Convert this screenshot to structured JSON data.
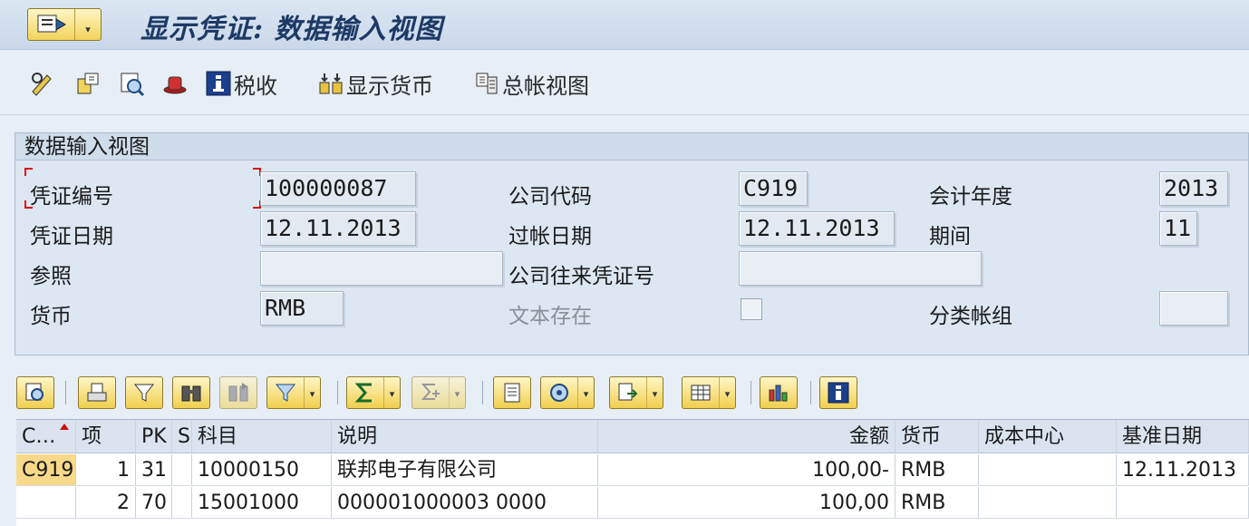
{
  "window": {
    "title": "显示凭证: 数据输入视图"
  },
  "menu_button": {
    "icon": "menu-icon",
    "dropdown": "▾"
  },
  "toolbar": {
    "items": [
      {
        "icon": "edit-glasses-icon",
        "label": ""
      },
      {
        "icon": "document-switch-icon",
        "label": ""
      },
      {
        "icon": "display-document-icon",
        "label": ""
      },
      {
        "icon": "hat-icon",
        "label": ""
      },
      {
        "icon": "info-icon",
        "label": "税收"
      },
      {
        "icon": "currency-icon",
        "label": "显示货币"
      },
      {
        "icon": "ledger-view-icon",
        "label": "总帐视图"
      }
    ]
  },
  "header": {
    "section_title": "数据输入视图",
    "doc_number_label": "凭证编号",
    "doc_number": "100000087",
    "company_code_label": "公司代码",
    "company_code": "C919",
    "fiscal_year_label": "会计年度",
    "fiscal_year": "2013",
    "doc_date_label": "凭证日期",
    "doc_date": "12.11.2013",
    "posting_date_label": "过帐日期",
    "posting_date": "12.11.2013",
    "period_label": "期间",
    "period": "11",
    "reference_label": "参照",
    "reference": "",
    "intercompany_label": "公司往来凭证号",
    "intercompany": "",
    "currency_label": "货币",
    "currency": "RMB",
    "text_exists_label": "文本存在",
    "text_exists": false,
    "ledger_group_label": "分类帐组",
    "ledger_group": ""
  },
  "grid": {
    "columns": [
      "C…",
      "项",
      "PK",
      "S",
      "科目",
      "说明",
      "金额",
      "货币",
      "成本中心",
      "基准日期"
    ],
    "rows": [
      {
        "company": "C919",
        "item": "1",
        "pk": "31",
        "s": "",
        "account": "10000150",
        "text": "联邦电子有限公司",
        "amount": "100,00-",
        "currency": "RMB",
        "cost_center": "",
        "baseline_date": "12.11.2013"
      },
      {
        "company": "",
        "item": "2",
        "pk": "70",
        "s": "",
        "account": "15001000",
        "text": "000001000003 0000",
        "amount": "100,00",
        "currency": "RMB",
        "cost_center": "",
        "baseline_date": ""
      }
    ]
  },
  "colors": {
    "accent_yellow": "#f0cf4e",
    "title_blue": "#1d3a66",
    "focus_red": "#d11111"
  }
}
